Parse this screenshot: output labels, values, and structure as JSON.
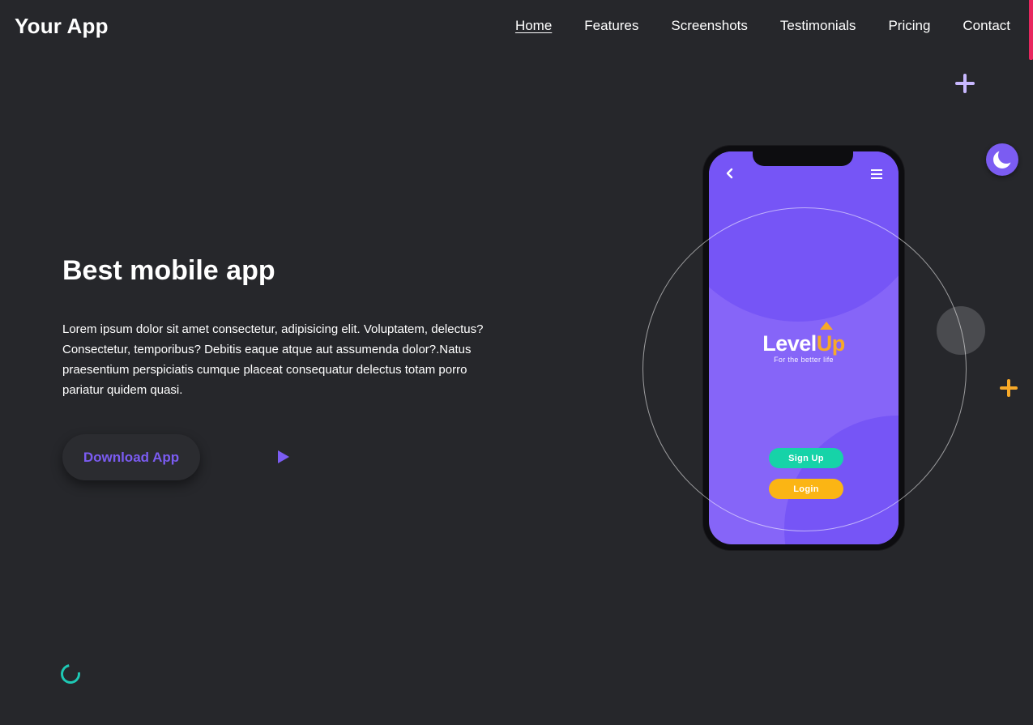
{
  "header": {
    "logo": "Your App",
    "nav": [
      "Home",
      "Features",
      "Screenshots",
      "Testimonials",
      "Pricing",
      "Contact"
    ],
    "active_nav": "Home"
  },
  "hero": {
    "title": "Best mobile app",
    "description": "Lorem ipsum dolor sit amet consectetur, adipisicing elit. Voluptatem, delectus? Consectetur, temporibus? Debitis eaque atque aut assumenda dolor?.Natus praesentium perspiciatis cumque placeat consequatur delectus totam porro pariatur quidem quasi.",
    "download_label": "Download App"
  },
  "phone": {
    "brand_level": "Level",
    "brand_up": "Up",
    "tagline": "For the better life",
    "signup_label": "Sign Up",
    "login_label": "Login"
  },
  "icons": {
    "play": "play-icon",
    "theme_toggle": "moon-icon",
    "plus_purple": "plus-icon",
    "plus_orange": "plus-icon",
    "loader": "spinner-icon",
    "back": "chevron-left-icon",
    "menu": "hamburger-icon"
  },
  "colors": {
    "background": "#26272b",
    "accent_purple": "#7b5cf2",
    "accent_orange": "#f7a928",
    "accent_teal": "#16d3a8",
    "scroll_thumb": "#e8265e"
  }
}
